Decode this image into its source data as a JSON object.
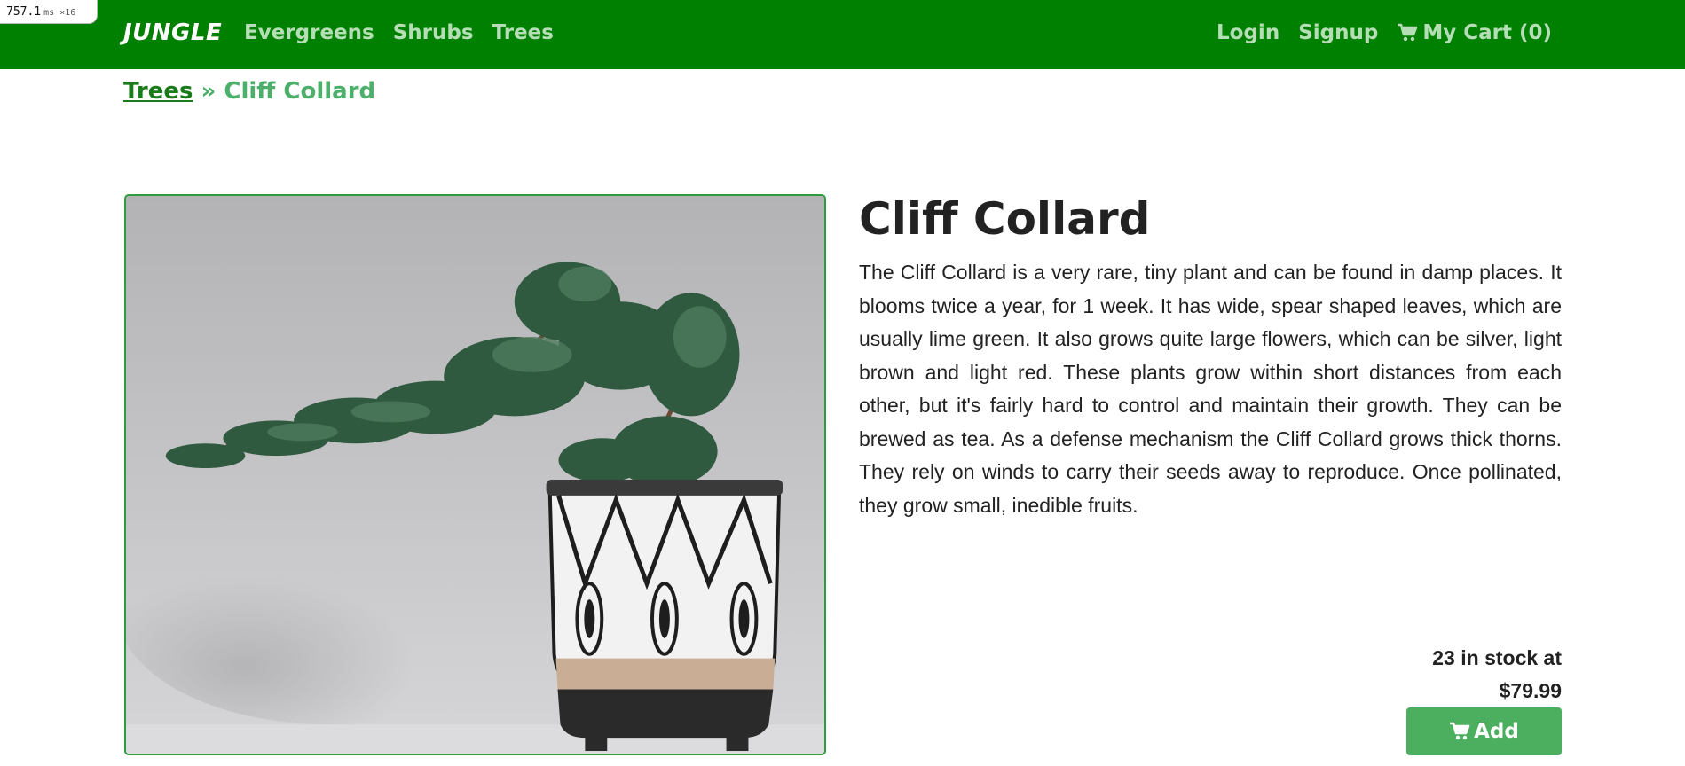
{
  "perf": {
    "value": "757.1",
    "suffix": "ms ×16"
  },
  "navbar": {
    "brand": "JUNGLE",
    "left_links": [
      "Evergreens",
      "Shrubs",
      "Trees"
    ],
    "login": "Login",
    "signup": "Signup",
    "cart_label": "My Cart (0)",
    "background": "#008000",
    "link_color": "#b6deb6"
  },
  "breadcrumb": {
    "parent": "Trees",
    "separator": "»",
    "current": "Cliff Collard"
  },
  "product": {
    "image_alt": "Bonsai tree in patterned pot",
    "title": "Cliff Collard",
    "description": "The Cliff Collard is a very rare, tiny plant and can be found in damp places. It blooms twice a year, for 1 week. It has wide, spear shaped leaves, which are usually lime green. It also grows quite large flowers, which can be silver, light brown and light red. These plants grow within short distances from each other, but it's fairly hard to control and maintain their growth. They can be brewed as tea. As a defense mechanism the Cliff Collard grows thick thorns. They rely on winds to carry their seeds away to reproduce. Once pollinated, they grow small, inedible fruits.",
    "stock_line": "23 in stock at",
    "price": "$79.99",
    "add_label": "Add",
    "accent": "#4caf5f"
  },
  "icons": {
    "cart": "shopping-cart-icon"
  }
}
